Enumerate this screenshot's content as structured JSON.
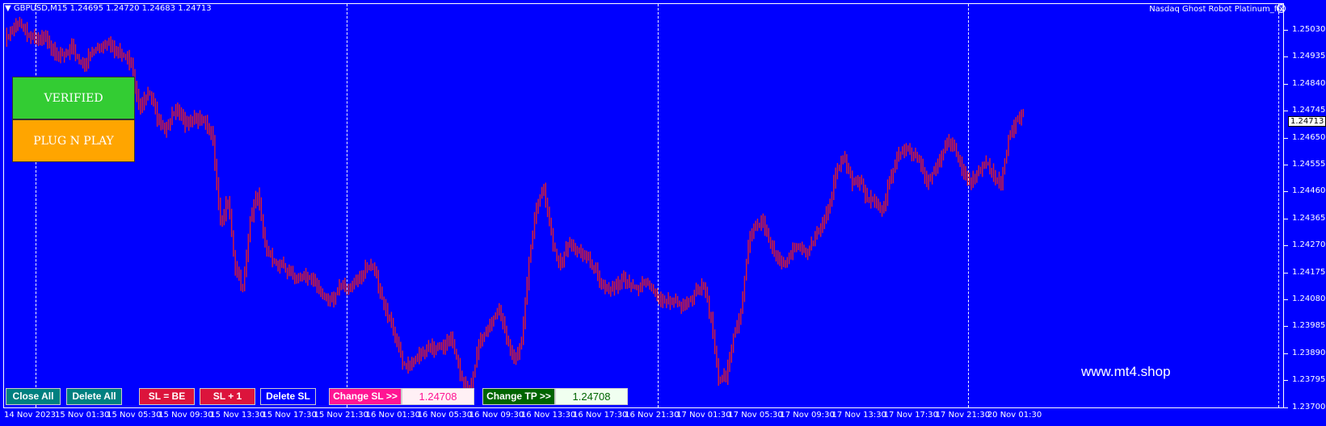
{
  "header": {
    "title": "GBPUSD,M15  1.24695 1.24720 1.24683 1.24713",
    "ea_name": "Nasdaq Ghost Robot Platinum_fix"
  },
  "price_axis": {
    "labels": [
      "1.25030",
      "1.24935",
      "1.24840",
      "1.24745",
      "1.24650",
      "1.24555",
      "1.24460",
      "1.24365",
      "1.24270",
      "1.24175",
      "1.24080",
      "1.23985",
      "1.23890",
      "1.23795",
      "1.23700"
    ],
    "current": "1.24713"
  },
  "time_axis": [
    "14 Nov 2023",
    "15 Nov 01:30",
    "15 Nov 05:30",
    "15 Nov 09:30",
    "15 Nov 13:30",
    "15 Nov 17:30",
    "15 Nov 21:30",
    "16 Nov 01:30",
    "16 Nov 05:30",
    "16 Nov 09:30",
    "16 Nov 13:30",
    "16 Nov 17:30",
    "16 Nov 21:30",
    "17 Nov 01:30",
    "17 Nov 05:30",
    "17 Nov 09:30",
    "17 Nov 13:30",
    "17 Nov 17:30",
    "17 Nov 21:30",
    "20 Nov 01:30"
  ],
  "panel": {
    "verified": "VERIFIED",
    "plug": "PLUG N PLAY"
  },
  "buttons": {
    "close_all": "Close All",
    "delete_all": "Delete All",
    "sl_be": "SL = BE",
    "sl_plus_one": "SL + 1",
    "delete_sl": "Delete SL",
    "change_sl": "Change SL >>",
    "sl_value": "1.24708",
    "change_tp": "Change TP >>",
    "tp_value": "1.24708"
  },
  "watermark": "www.mt4.shop",
  "colors": {
    "background": "#0000ff",
    "candles": "#e0202a",
    "verified": "#33cc33",
    "plug": "#ffa500"
  },
  "chart_data": {
    "type": "candlestick",
    "symbol": "GBPUSD",
    "timeframe": "M15",
    "ylim": [
      1.237,
      1.2508
    ],
    "close_path": [
      [
        0,
        1.2496
      ],
      [
        8,
        1.2503
      ],
      [
        16,
        1.2496
      ],
      [
        22,
        1.2497
      ],
      [
        30,
        1.249
      ],
      [
        36,
        1.2493
      ],
      [
        42,
        1.2488
      ],
      [
        50,
        1.2494
      ],
      [
        56,
        1.2496
      ],
      [
        62,
        1.2492
      ],
      [
        68,
        1.2489
      ],
      [
        72,
        1.2474
      ],
      [
        78,
        1.2478
      ],
      [
        82,
        1.247
      ],
      [
        86,
        1.2466
      ],
      [
        92,
        1.2472
      ],
      [
        96,
        1.2468
      ],
      [
        102,
        1.247
      ],
      [
        108,
        1.2467
      ],
      [
        112,
        1.2462
      ],
      [
        116,
        1.2434
      ],
      [
        120,
        1.244
      ],
      [
        124,
        1.2418
      ],
      [
        128,
        1.2411
      ],
      [
        132,
        1.2435
      ],
      [
        136,
        1.2443
      ],
      [
        140,
        1.2426
      ],
      [
        144,
        1.2421
      ],
      [
        150,
        1.2418
      ],
      [
        156,
        1.2414
      ],
      [
        162,
        1.2416
      ],
      [
        168,
        1.2411
      ],
      [
        174,
        1.2407
      ],
      [
        180,
        1.241
      ],
      [
        186,
        1.2412
      ],
      [
        192,
        1.2416
      ],
      [
        198,
        1.2418
      ],
      [
        202,
        1.241
      ],
      [
        206,
        1.2402
      ],
      [
        210,
        1.2394
      ],
      [
        214,
        1.2384
      ],
      [
        220,
        1.2386
      ],
      [
        226,
        1.2389
      ],
      [
        234,
        1.2391
      ],
      [
        240,
        1.2393
      ],
      [
        246,
        1.238
      ],
      [
        250,
        1.2376
      ],
      [
        256,
        1.2392
      ],
      [
        262,
        1.24
      ],
      [
        266,
        1.2404
      ],
      [
        270,
        1.2393
      ],
      [
        274,
        1.2386
      ],
      [
        278,
        1.2393
      ],
      [
        282,
        1.242
      ],
      [
        286,
        1.2438
      ],
      [
        290,
        1.2446
      ],
      [
        294,
        1.243
      ],
      [
        298,
        1.2418
      ],
      [
        304,
        1.2426
      ],
      [
        310,
        1.2424
      ],
      [
        316,
        1.2418
      ],
      [
        322,
        1.2412
      ],
      [
        328,
        1.241
      ],
      [
        334,
        1.2414
      ],
      [
        340,
        1.2411
      ],
      [
        346,
        1.2412
      ],
      [
        352,
        1.2408
      ],
      [
        358,
        1.2406
      ],
      [
        364,
        1.2405
      ],
      [
        370,
        1.2408
      ],
      [
        376,
        1.2411
      ],
      [
        380,
        1.24
      ],
      [
        384,
        1.238
      ],
      [
        388,
        1.2379
      ],
      [
        392,
        1.2394
      ],
      [
        396,
        1.2403
      ],
      [
        400,
        1.2426
      ],
      [
        404,
        1.2432
      ],
      [
        408,
        1.2433
      ],
      [
        412,
        1.2427
      ],
      [
        416,
        1.242
      ],
      [
        420,
        1.2418
      ],
      [
        424,
        1.2425
      ],
      [
        428,
        1.2426
      ],
      [
        432,
        1.2423
      ],
      [
        436,
        1.2428
      ],
      [
        440,
        1.2434
      ],
      [
        444,
        1.2441
      ],
      [
        448,
        1.2452
      ],
      [
        452,
        1.2455
      ],
      [
        456,
        1.2448
      ],
      [
        460,
        1.2448
      ],
      [
        464,
        1.244
      ],
      [
        468,
        1.2442
      ],
      [
        472,
        1.2438
      ],
      [
        476,
        1.2447
      ],
      [
        480,
        1.2455
      ],
      [
        484,
        1.246
      ],
      [
        488,
        1.2458
      ],
      [
        492,
        1.2454
      ],
      [
        496,
        1.2446
      ],
      [
        500,
        1.2452
      ],
      [
        504,
        1.2457
      ],
      [
        508,
        1.246
      ],
      [
        512,
        1.2458
      ],
      [
        516,
        1.2451
      ],
      [
        520,
        1.2447
      ],
      [
        524,
        1.245
      ],
      [
        528,
        1.2455
      ],
      [
        532,
        1.245
      ],
      [
        536,
        1.2446
      ],
      [
        540,
        1.2462
      ],
      [
        544,
        1.2469
      ],
      [
        548,
        1.2472
      ]
    ]
  }
}
